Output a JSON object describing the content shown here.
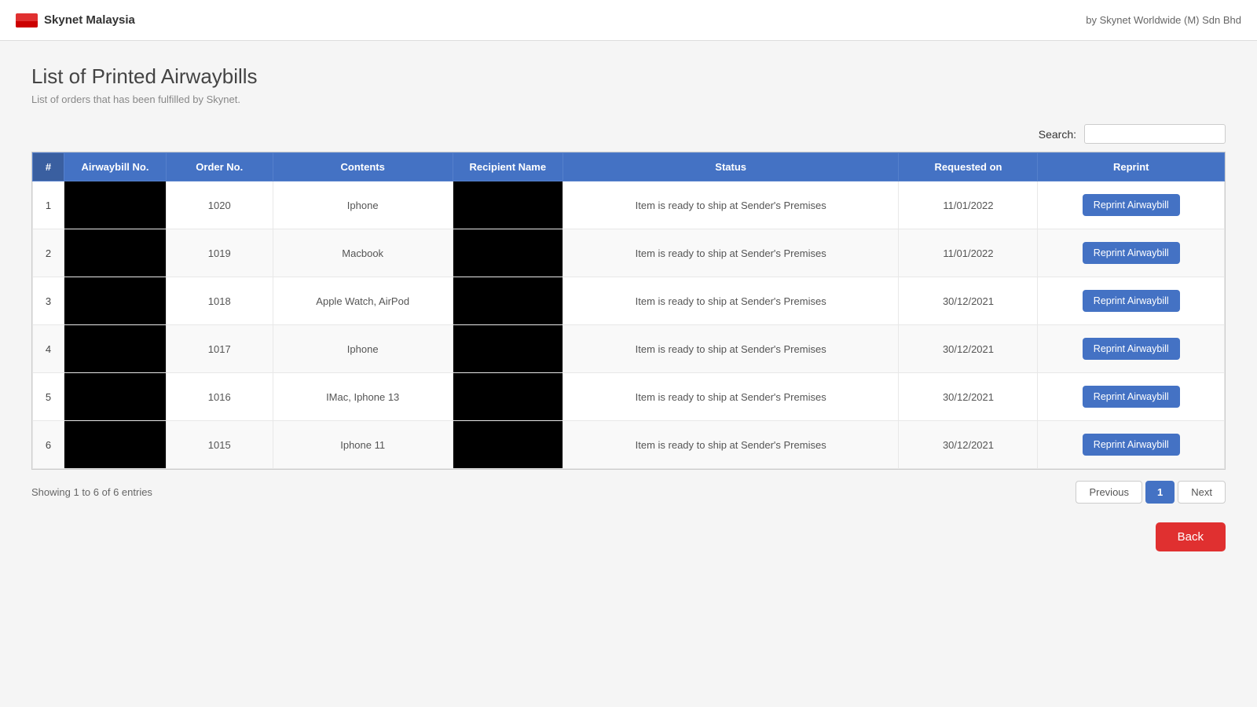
{
  "header": {
    "brand": "Skynet Malaysia",
    "tagline": "by Skynet Worldwide (M) Sdn Bhd"
  },
  "page": {
    "title": "List of Printed Airwaybills",
    "subtitle": "List of orders that has been fulfilled by Skynet.",
    "entries_info": "Showing 1 to 6 of 6 entries"
  },
  "search": {
    "label": "Search:",
    "placeholder": ""
  },
  "table": {
    "columns": [
      "#",
      "Airwaybill No.",
      "Order No.",
      "Contents",
      "Recipient Name",
      "Status",
      "Requested on",
      "Reprint"
    ],
    "rows": [
      {
        "num": 1,
        "airwaybill": "REDACTED",
        "order_no": "1020",
        "contents": "Iphone",
        "recipient": "REDACTED",
        "status": "Item is ready to ship at Sender's Premises",
        "requested_on": "11/01/2022",
        "reprint_label": "Reprint Airwaybill"
      },
      {
        "num": 2,
        "airwaybill": "REDACTED",
        "order_no": "1019",
        "contents": "Macbook",
        "recipient": "REDACTED",
        "status": "Item is ready to ship at Sender's Premises",
        "requested_on": "11/01/2022",
        "reprint_label": "Reprint Airwaybill"
      },
      {
        "num": 3,
        "airwaybill": "REDACTED",
        "order_no": "1018",
        "contents": "Apple Watch, AirPod",
        "recipient": "REDACTED",
        "status": "Item is ready to ship at Sender's Premises",
        "requested_on": "30/12/2021",
        "reprint_label": "Reprint Airwaybill"
      },
      {
        "num": 4,
        "airwaybill": "REDACTED",
        "order_no": "1017",
        "contents": "Iphone",
        "recipient": "REDACTED",
        "status": "Item is ready to ship at Sender's Premises",
        "requested_on": "30/12/2021",
        "reprint_label": "Reprint Airwaybill"
      },
      {
        "num": 5,
        "airwaybill": "REDACTED",
        "order_no": "1016",
        "contents": "IMac, Iphone 13",
        "recipient": "REDACTED",
        "status": "Item is ready to ship at Sender's Premises",
        "requested_on": "30/12/2021",
        "reprint_label": "Reprint Airwaybill"
      },
      {
        "num": 6,
        "airwaybill": "REDACTED",
        "order_no": "1015",
        "contents": "Iphone 11",
        "recipient": "REDACTED",
        "status": "Item is ready to ship at Sender's Premises",
        "requested_on": "30/12/2021",
        "reprint_label": "Reprint Airwaybill"
      }
    ]
  },
  "pagination": {
    "previous_label": "Previous",
    "next_label": "Next",
    "current_page": "1"
  },
  "back_button": {
    "label": "Back"
  }
}
